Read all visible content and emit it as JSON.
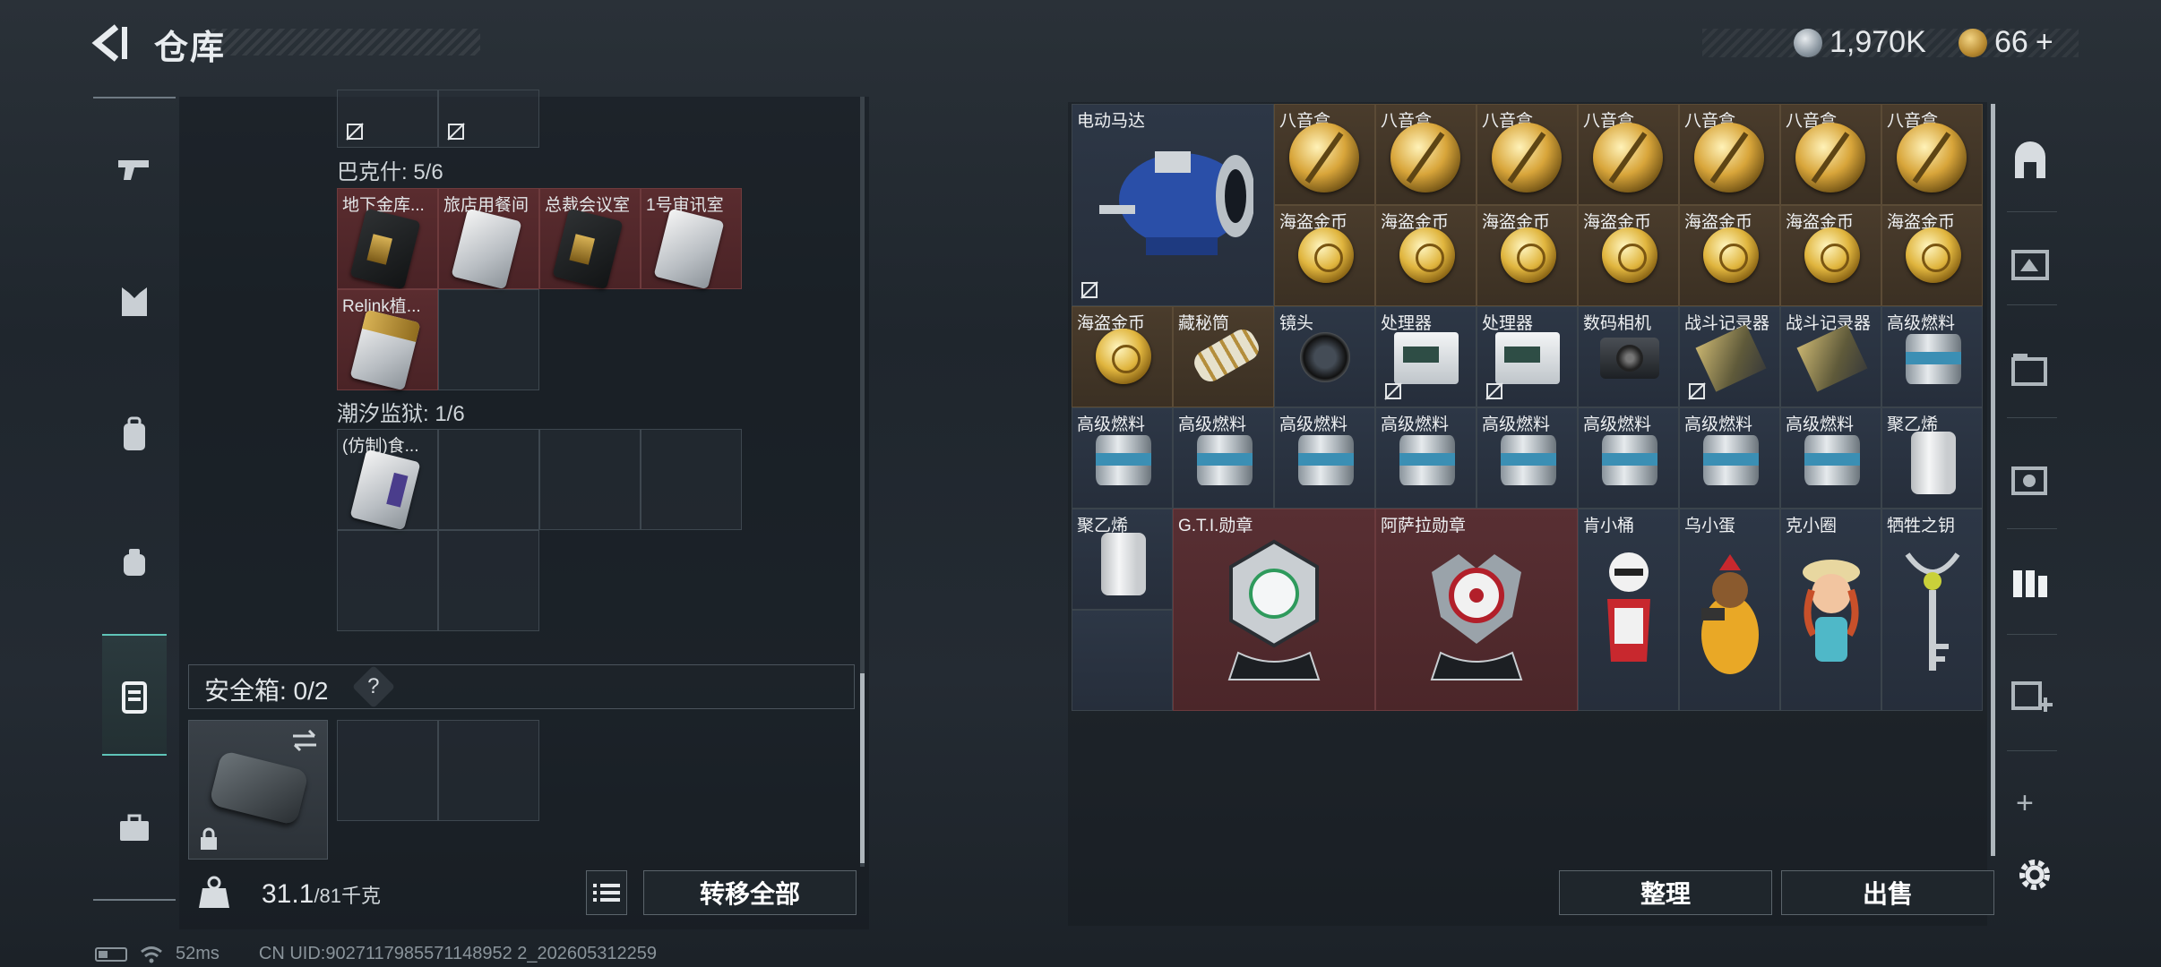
{
  "header": {
    "title": "仓库",
    "silver": "1,970K",
    "gold": "66",
    "gold_plus": "+"
  },
  "left_groups": {
    "bakeshi": {
      "label": "巴克什: 5/6",
      "items": [
        "地下金库...",
        "旅店用餐间",
        "总裁会议室",
        "1号审讯室",
        "Relink植..."
      ]
    },
    "chaoxi": {
      "label": "潮汐监狱: 1/6",
      "items": [
        "(仿制)食..."
      ]
    }
  },
  "safe": {
    "label": "安全箱: 0/2",
    "help": "?"
  },
  "capacity": {
    "current": "31.1",
    "max": "/81千克"
  },
  "buttons": {
    "transfer_all": "转移全部",
    "sort": "整理",
    "sell": "出售",
    "plus": "+"
  },
  "stash": {
    "row0": [
      "电动马达",
      "八音盒",
      "八音盒",
      "八音盒",
      "八音盒",
      "八音盒",
      "八音盒",
      "八音盒"
    ],
    "row1": [
      "海盗金币",
      "海盗金币",
      "海盗金币",
      "海盗金币",
      "海盗金币",
      "海盗金币",
      "海盗金币"
    ],
    "row2": [
      "海盗金币",
      "藏秘筒",
      "镜头",
      "处理器",
      "处理器",
      "数码相机",
      "战斗记录器",
      "战斗记录器",
      "高级燃料"
    ],
    "row3": [
      "高级燃料",
      "高级燃料",
      "高级燃料",
      "高级燃料",
      "高级燃料",
      "高级燃料",
      "高级燃料",
      "高级燃料",
      "聚乙烯"
    ],
    "row4": [
      "聚乙烯",
      "G.T.I.勋章",
      "阿萨拉勋章",
      "肯小桶",
      "乌小蛋",
      "克小圈",
      "牺牲之钥"
    ]
  },
  "status": {
    "ping": "52ms",
    "uid": "CN UID:9027117985571148952 2_202605312259"
  }
}
